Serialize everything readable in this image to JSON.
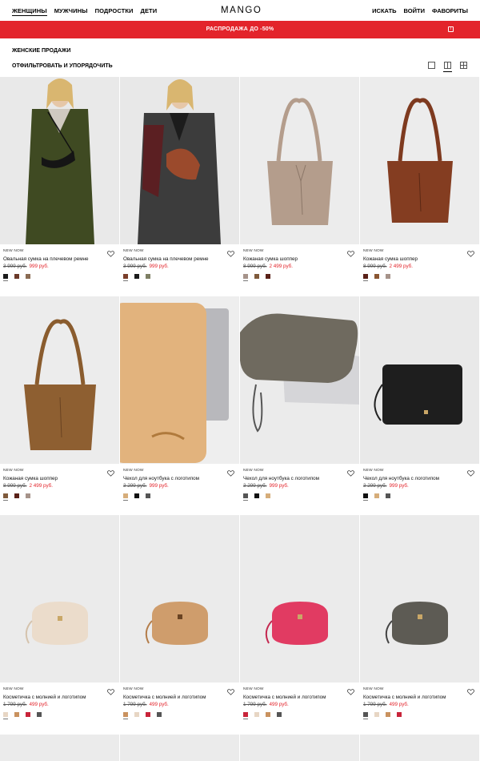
{
  "header": {
    "nav_left": [
      "ЖЕНЩИНЫ",
      "МУЖЧИНЫ",
      "ПОДРОСТКИ",
      "ДЕТИ"
    ],
    "logo": "MANGO",
    "nav_right": [
      "ИСКАТЬ",
      "ВОЙТИ",
      "ФАВОРИТЫ"
    ]
  },
  "banner": {
    "text": "РАСПРОДАЖА ДО -50%",
    "info_icon": "i"
  },
  "page": {
    "title": "ЖЕНСКИЕ ПРОДАЖИ",
    "filter_label": "ОТФИЛЬТРОВАТЬ И УПОРЯДОЧИТЬ"
  },
  "colors": {
    "sale": "#e3242b",
    "banner_bg": "#e3242b"
  },
  "products": [
    {
      "badge": "NEW NOW",
      "name": "Овальная сумка на плечевом ремне",
      "old_price": "3 999 руб.",
      "new_price": "999 руб.",
      "swatches": [
        "#1b1b1b",
        "#6b3a2a",
        "#8a6b53"
      ]
    },
    {
      "badge": "NEW NOW",
      "name": "Овальная сумка на плечевом ремне",
      "old_price": "3 999 руб.",
      "new_price": "999 руб.",
      "swatches": [
        "#7a3e2a",
        "#1b1b1b",
        "#7e7f64"
      ]
    },
    {
      "badge": "NEW NOW",
      "name": "Кожаная сумка шоппер",
      "old_price": "8 999 руб.",
      "new_price": "2 499 руб.",
      "swatches": [
        "#a6938a",
        "#7f5a3c",
        "#5a2118"
      ]
    },
    {
      "badge": "NEW NOW",
      "name": "Кожаная сумка шоппер",
      "old_price": "8 999 руб.",
      "new_price": "2 499 руб.",
      "swatches": [
        "#5a2118",
        "#8a5632",
        "#a6938a"
      ]
    },
    {
      "badge": "NEW NOW",
      "name": "Кожаная сумка шоппер",
      "old_price": "8 999 руб.",
      "new_price": "2 499 руб.",
      "swatches": [
        "#7f5a3c",
        "#5a2118",
        "#a6938a"
      ]
    },
    {
      "badge": "NEW NOW",
      "name": "Чехол для ноутбука с логотипом",
      "old_price": "3 299 руб.",
      "new_price": "999 руб.",
      "swatches": [
        "#d6ad7a",
        "#111111",
        "#555555"
      ]
    },
    {
      "badge": "NEW NOW",
      "name": "Чехол для ноутбука с логотипом",
      "old_price": "3 299 руб.",
      "new_price": "999 руб.",
      "swatches": [
        "#555555",
        "#111111",
        "#d6ad7a"
      ]
    },
    {
      "badge": "NEW NOW",
      "name": "Чехол для ноутбука с логотипом",
      "old_price": "3 299 руб.",
      "new_price": "999 руб.",
      "swatches": [
        "#111111",
        "#d6ad7a",
        "#555555"
      ]
    },
    {
      "badge": "NEW NOW",
      "name": "Косметичка с молнией и логотипом",
      "old_price": "1 799 руб.",
      "new_price": "499 руб.",
      "swatches": [
        "#e7d6c4",
        "#c9925f",
        "#c8243a",
        "#555555"
      ]
    },
    {
      "badge": "NEW NOW",
      "name": "Косметичка с молнией и логотипом",
      "old_price": "1 799 руб.",
      "new_price": "499 руб.",
      "swatches": [
        "#c9925f",
        "#e7d6c4",
        "#c8243a",
        "#555555"
      ]
    },
    {
      "badge": "NEW NOW",
      "name": "Косметичка с молнией и логотипом",
      "old_price": "1 799 руб.",
      "new_price": "499 руб.",
      "swatches": [
        "#c8243a",
        "#e7d6c4",
        "#c9925f",
        "#555555"
      ]
    },
    {
      "badge": "NEW NOW",
      "name": "Косметичка с молнией и логотипом",
      "old_price": "1 799 руб.",
      "new_price": "499 руб.",
      "swatches": [
        "#555555",
        "#e7d6c4",
        "#c9925f",
        "#c8243a"
      ]
    }
  ]
}
